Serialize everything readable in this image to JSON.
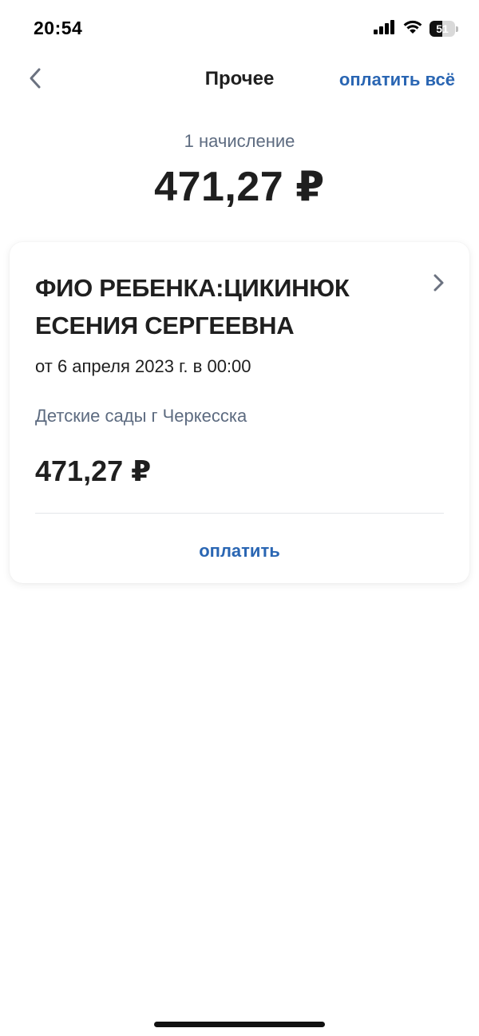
{
  "status_bar": {
    "time": "20:54",
    "battery_level": "51",
    "battery_fraction": 0.51,
    "icons": [
      "cellular-signal-icon",
      "wifi-icon",
      "battery-icon"
    ]
  },
  "nav": {
    "back_icon": "chevron-left-icon",
    "title": "Прочее",
    "pay_all_label": "оплатить всё"
  },
  "summary": {
    "count_label": "1 начисление",
    "total": "471,27 ₽"
  },
  "charges": [
    {
      "title": "ФИО РЕБЕНКА:ЦИКИНЮК ЕСЕНИЯ СЕРГЕЕВНА",
      "date": "от 6 апреля 2023 г. в 00:00",
      "organization": "Детские сады г Черкесска",
      "amount": "471,27 ₽",
      "pay_label": "оплатить",
      "chevron_icon": "chevron-right-icon"
    }
  ],
  "colors": {
    "accent": "#2a66b3",
    "text_primary": "#1f1f1f",
    "text_secondary": "#5d6b80",
    "background": "#ffffff"
  }
}
